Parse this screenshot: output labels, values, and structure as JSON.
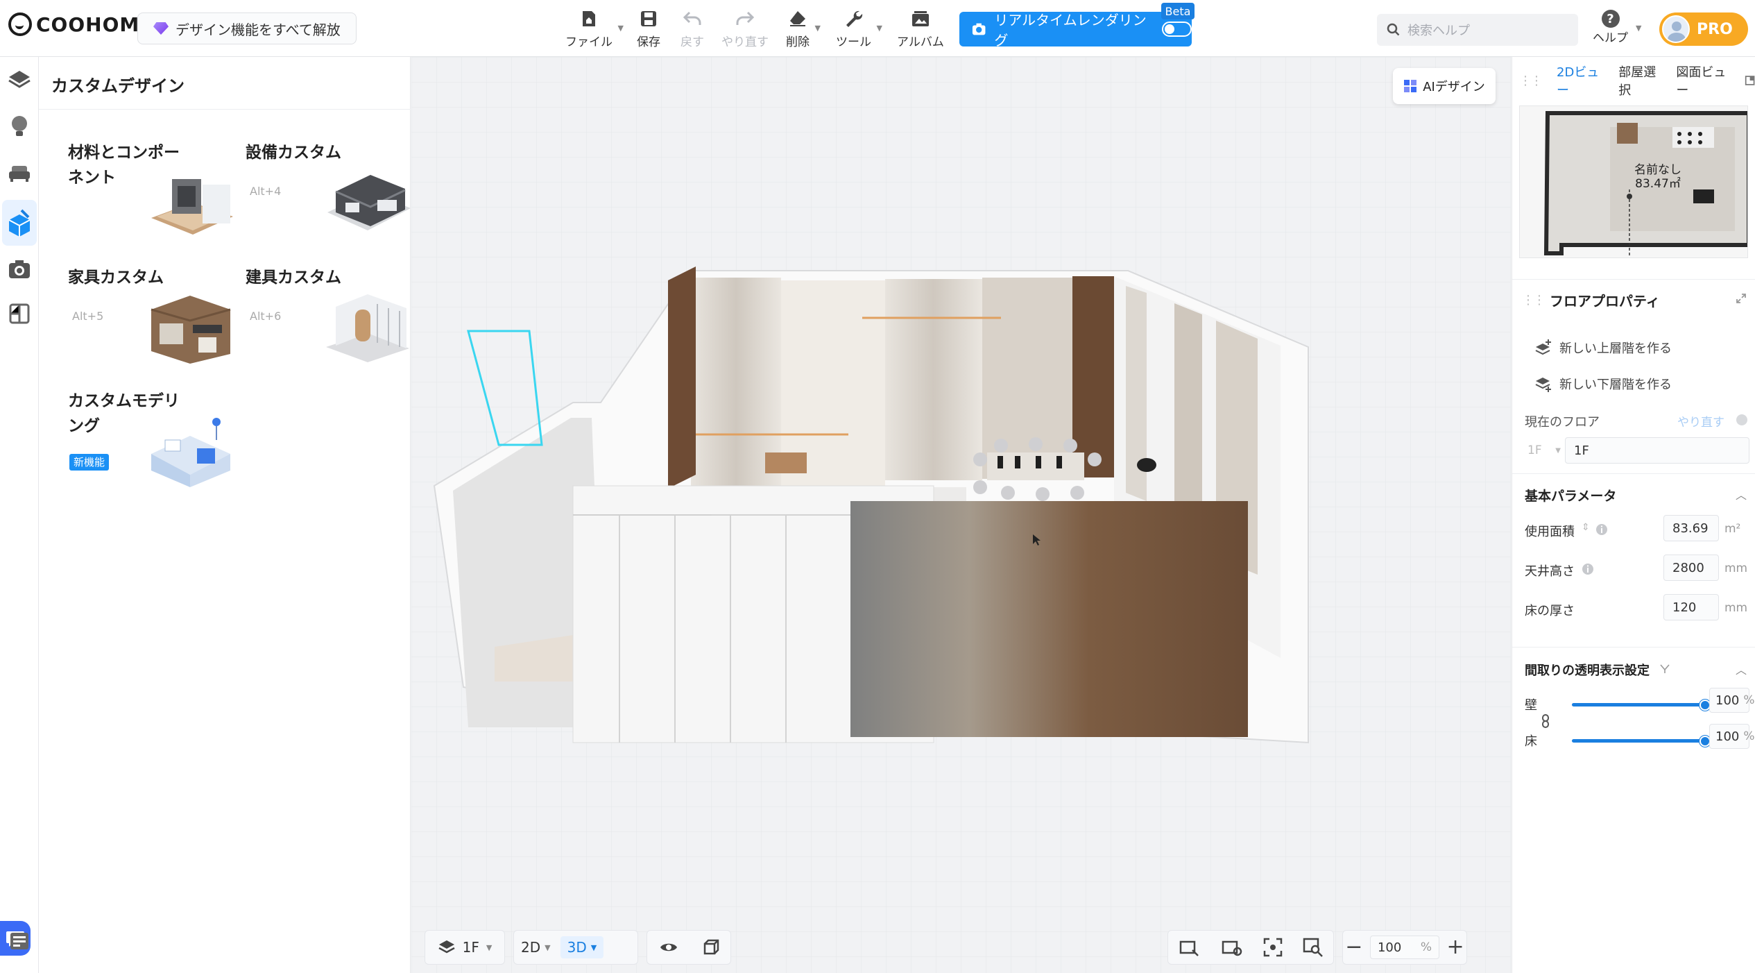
{
  "app": {
    "logo": "COOHOM",
    "unlock_label": "デザイン機能をすべて解放"
  },
  "toolbar": {
    "items": [
      {
        "label": "ファイル",
        "icon": "file-home-icon",
        "has_menu": true,
        "enabled": true
      },
      {
        "label": "保存",
        "icon": "save-icon",
        "has_menu": false,
        "enabled": true
      },
      {
        "label": "戻す",
        "icon": "undo-icon",
        "has_menu": false,
        "enabled": false
      },
      {
        "label": "やり直す",
        "icon": "redo-icon",
        "has_menu": false,
        "enabled": false
      },
      {
        "label": "削除",
        "icon": "eraser-icon",
        "has_menu": true,
        "enabled": true
      },
      {
        "label": "ツール",
        "icon": "wrench-icon",
        "has_menu": true,
        "enabled": true
      },
      {
        "label": "アルバム",
        "icon": "album-icon",
        "has_menu": false,
        "enabled": true
      }
    ],
    "render_label": "リアルタイムレンダリング",
    "render_badge": "Beta",
    "search_placeholder": "検索ヘルプ",
    "help_label": "ヘルプ",
    "pro_label": "PRO"
  },
  "left_panel": {
    "title": "カスタムデザイン",
    "cards": [
      {
        "title": "材料とコンポーネント",
        "hint": "",
        "badge": ""
      },
      {
        "title": "設備カスタム",
        "hint": "Alt+4",
        "badge": ""
      },
      {
        "title": "家具カスタム",
        "hint": "Alt+5",
        "badge": ""
      },
      {
        "title": "建具カスタム",
        "hint": "Alt+6",
        "badge": ""
      },
      {
        "title": "カスタムモデリング",
        "hint": "",
        "badge": "新機能"
      }
    ]
  },
  "viewport": {
    "ai_design_label": "AIデザイン",
    "floor_select": "1F",
    "view_2d": "2D",
    "view_3d": "3D",
    "zoom_value": "100",
    "zoom_unit": "%"
  },
  "right_panel": {
    "tabs": [
      "2Dビュー",
      "部屋選択",
      "図面ビュー"
    ],
    "minimap_room_name": "名前なし",
    "minimap_room_area": "83.47㎡",
    "floor_props_title": "フロアプロパティ",
    "new_upper_floor": "新しい上層階を作る",
    "new_lower_floor": "新しい下層階を作る",
    "current_floor_label": "現在のフロア",
    "current_floor_redo": "やり直す",
    "current_floor_select": "1F",
    "current_floor_value": "1F",
    "basic_params_title": "基本パラメータ",
    "params": [
      {
        "label": "使用面積",
        "value": "83.69",
        "unit": "m²"
      },
      {
        "label": "天井高さ",
        "value": "2800",
        "unit": "mm"
      },
      {
        "label": "床の厚さ",
        "value": "120",
        "unit": "mm"
      }
    ],
    "transparency_title": "間取りの透明表示設定",
    "transparency_sliders": [
      {
        "label": "壁",
        "value": "100",
        "unit": "%",
        "fraction": 1.0
      },
      {
        "label": "床",
        "value": "100",
        "unit": "%",
        "fraction": 1.0
      }
    ]
  },
  "colors": {
    "accent": "#1a90f5",
    "pro": "#f8a923",
    "selection": "#3ad6f0"
  }
}
